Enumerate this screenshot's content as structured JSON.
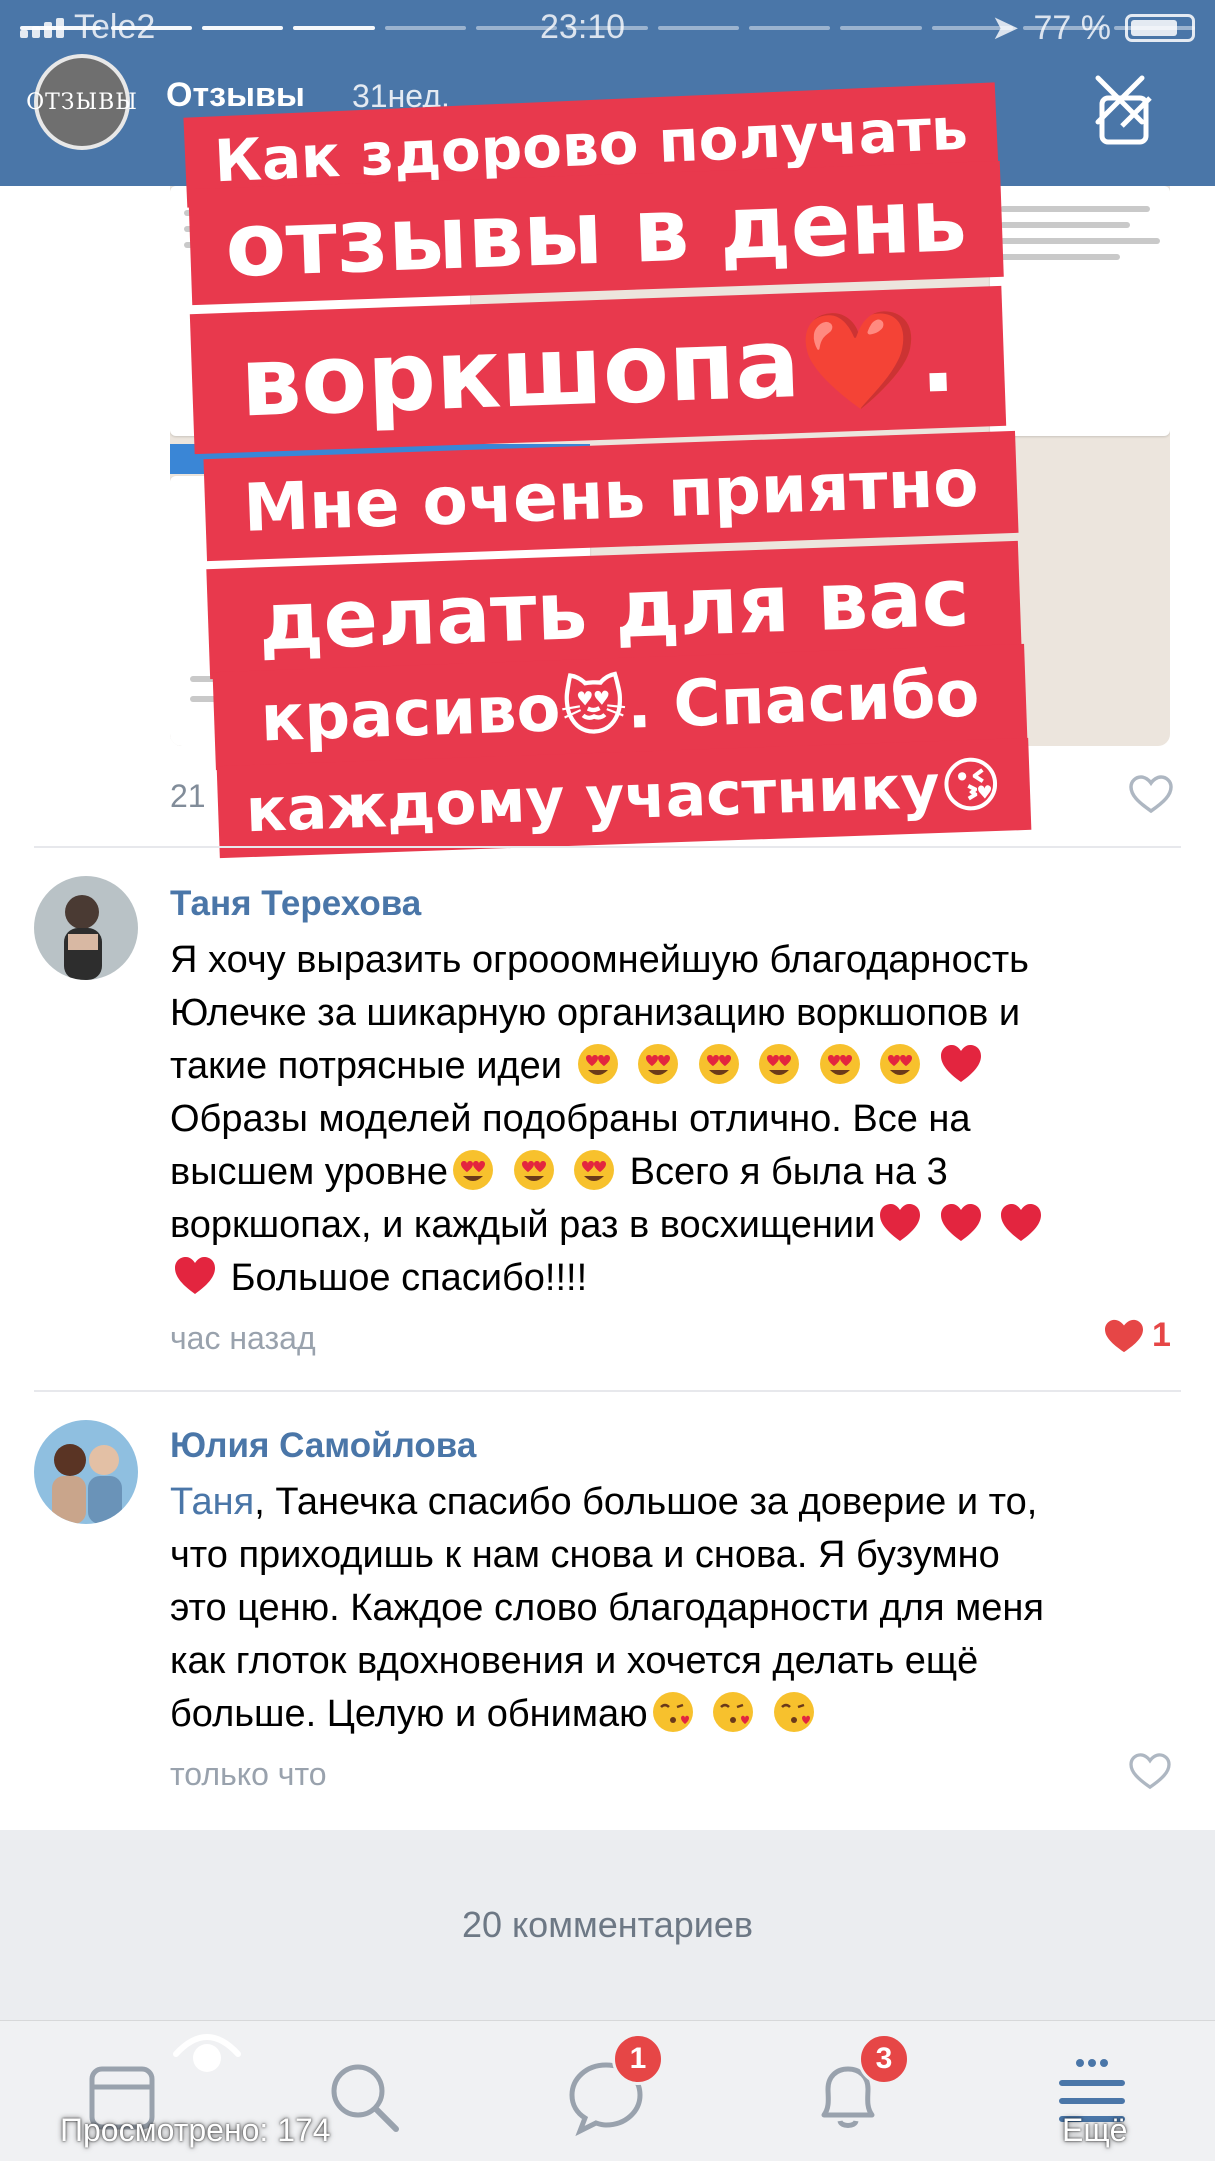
{
  "status_bar": {
    "carrier": "Tele2",
    "time": "23:10",
    "battery": "77 %"
  },
  "story": {
    "avatar_text": "ОТЗЫВЫ",
    "name": "Отзывы",
    "time": "31нед."
  },
  "post": {
    "likes_count": "21"
  },
  "banners": [
    "Как здорово получать",
    "отзывы в день",
    "воркшопа❤️.",
    "Мне очень приятно",
    "делать для вас",
    "красиво😻. Спасибо",
    "каждому участнику😘"
  ],
  "comments": [
    {
      "author": "Таня Терехова",
      "text_lines": [
        "Я хочу выразить огрооомнейшую благодарность",
        "Юлечке за шикарную организацию воркшопов и",
        "такие потрясные идеи",
        "Образы моделей подобраны отлично. Все на",
        "высшем уровне",
        "Всего я была на 3",
        "воркшопах, и каждый раз в восхищении",
        "Большое спасибо!!!!"
      ],
      "time": "час назад",
      "likes": "1",
      "liked": true
    },
    {
      "author": "Юлия Самойлова",
      "mention": "Таня",
      "text_lines": [
        ", Танечка спасибо большое за доверие и то,",
        "что приходишь к нам снова и снова. Я бузумно",
        "это ценю. Каждое слово благодарности для меня",
        "как глоток вдохновения и хочется делать ещё",
        "больше. Целую и обнимаю"
      ],
      "time": "только что",
      "liked": false
    }
  ],
  "all_comments_label": "20 комментариев",
  "tabbar": {
    "views_label": "Просмотрено: 174",
    "messages_badge": "1",
    "notifications_badge": "3",
    "more_label": "Ещё"
  },
  "colors": {
    "header": "#4a76a8",
    "banner": "#e8394d",
    "link": "#4a76a8",
    "like": "#e64646"
  },
  "icons": [
    "close-icon",
    "edit-icon",
    "heart-outline-icon",
    "heart-filled-icon",
    "newsfeed-icon",
    "search-icon",
    "messages-icon",
    "notifications-icon",
    "menu-icon",
    "eye-icon",
    "heart-eyes-emoji",
    "heart-emoji",
    "kiss-emoji",
    "heart-eyes-cat-emoji"
  ]
}
